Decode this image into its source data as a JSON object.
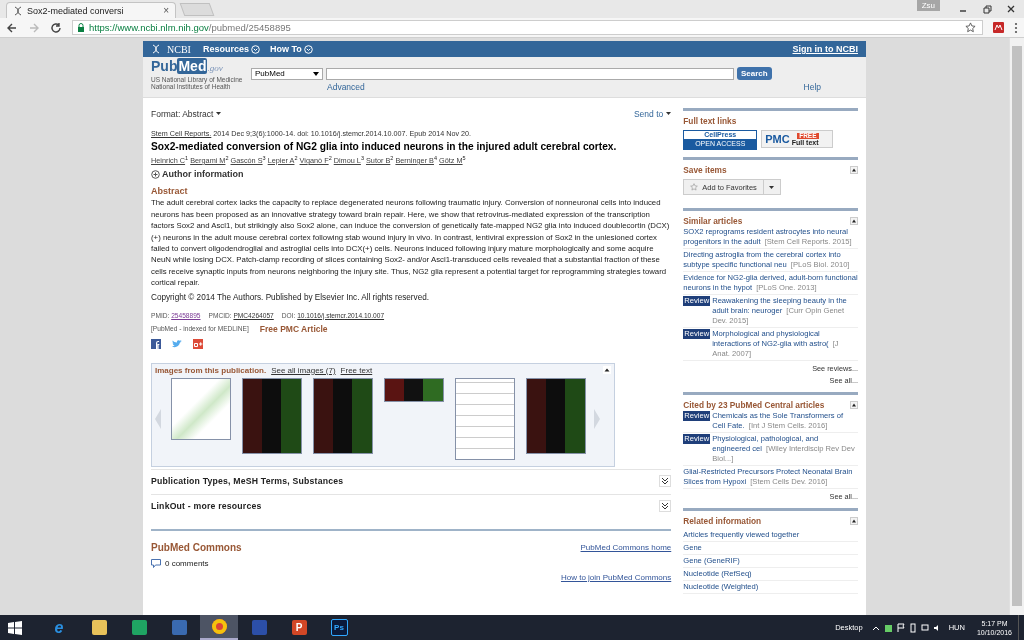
{
  "browser": {
    "tab_title": "Sox2-mediated conversi",
    "tab_close": "×",
    "user": "Zsu",
    "url_host": "https://www.ncbi.nlm.nih.gov",
    "url_path": "/pubmed/25458895"
  },
  "ncbi_bar": {
    "logo": "NCBI",
    "menus": [
      "Resources",
      "How To"
    ],
    "sign_in": "Sign in to NCBI"
  },
  "header": {
    "logo": {
      "pub": "Pub",
      "med": "Med",
      "suffix": ".gov"
    },
    "subtitle": [
      "US National Library of Medicine",
      "National Institutes of Health"
    ],
    "database": "PubMed",
    "search_button": "Search",
    "advanced": "Advanced",
    "help": "Help"
  },
  "article": {
    "format_label": "Format:",
    "format_value": "Abstract",
    "send_to": "Send to",
    "journal": "Stem Cell Reports.",
    "citation": " 2014 Dec 9;3(6):1000-14. doi: 10.1016/j.stemcr.2014.10.007. Epub 2014 Nov 20.",
    "title": "Sox2-mediated conversion of NG2 glia into induced neurons in the injured adult cerebral cortex.",
    "authors": [
      {
        "name": "Heinrich C",
        "sup": "1"
      },
      {
        "name": "Bergami M",
        "sup": "2"
      },
      {
        "name": "Gascón S",
        "sup": "3"
      },
      {
        "name": "Lepier A",
        "sup": "2"
      },
      {
        "name": "Viganò F",
        "sup": "2"
      },
      {
        "name": "Dimou L",
        "sup": "3"
      },
      {
        "name": "Sutor B",
        "sup": "2"
      },
      {
        "name": "Berninger B",
        "sup": "4"
      },
      {
        "name": "Götz M",
        "sup": "5"
      }
    ],
    "author_info": {
      "label": "Author information",
      "expanded": false
    },
    "abstract_heading": "Abstract",
    "abstract": "The adult cerebral cortex lacks the capacity to replace degenerated neurons following traumatic injury. Conversion of nonneuronal cells into induced neurons has been proposed as an innovative strategy toward brain repair. Here, we show that retrovirus-mediated expression of the transcription factors Sox2 and Ascl1, but strikingly also Sox2 alone, can induce the conversion of genetically fate-mapped NG2 glia into induced doublecortin (DCX)(+) neurons in the adult mouse cerebral cortex following stab wound injury in vivo. In contrast, lentiviral expression of Sox2 in the unlesioned cortex failed to convert oligodendroglial and astroglial cells into DCX(+) cells. Neurons induced following injury mature morphologically and some acquire NeuN while losing DCX. Patch-clamp recording of slices containing Sox2- and/or Ascl1-transduced cells revealed that a substantial fraction of these cells receive synaptic inputs from neurons neighboring the injury site. Thus, NG2 glia represent a potential target for reprogramming strategies toward cortical repair.",
    "copyright": "Copyright © 2014 The Authors. Published by Elsevier Inc. All rights reserved.",
    "ids": [
      {
        "label": "PMID:",
        "value": "25458895"
      },
      {
        "label": "PMCID:",
        "value": "PMC4264057"
      },
      {
        "label": "DOI:",
        "value": "10.1016/j.stemcr.2014.10.007"
      }
    ],
    "indexed": "[PubMed - indexed for MEDLINE]",
    "free_pmc": "Free PMC Article",
    "images": {
      "heading": "Images from this publication.",
      "links": [
        "See all images (7)",
        "Free text"
      ],
      "thumbnails": [
        {
          "kind": "diagram"
        },
        {
          "kind": "micrograph"
        },
        {
          "kind": "micrograph"
        },
        {
          "kind": "strip"
        },
        {
          "kind": "chart"
        },
        {
          "kind": "micrograph"
        }
      ]
    },
    "sections": [
      {
        "label": "Publication Types, MeSH Terms, Substances",
        "expanded": false
      },
      {
        "label": "LinkOut - more resources",
        "expanded": false
      }
    ],
    "commons": {
      "heading": "PubMed Commons",
      "home_link": "PubMed Commons home",
      "comments": "0 comments",
      "join_link": "How to join PubMed Commons"
    }
  },
  "sidebar": {
    "full_text": {
      "heading": "Full text links",
      "cellpress": {
        "top": "CellPress",
        "bottom": "OPEN ACCESS"
      },
      "pmc": {
        "logo": "PMC",
        "free": "FREE",
        "label": "Full text"
      }
    },
    "save": {
      "heading": "Save items",
      "button": "Add to Favorites",
      "expanded": true
    },
    "similar": {
      "heading": "Similar articles",
      "expanded": true,
      "items": [
        {
          "title": "SOX2 reprograms resident astrocytes into neural progenitors in the adult",
          "source": "[Stem Cell Reports. 2015]"
        },
        {
          "title": "Directing astroglia from the cerebral cortex into subtype specific functional neu",
          "source": "[PLoS Biol. 2010]"
        },
        {
          "title": "Evidence for NG2-glia derived, adult-born functional neurons in the hypot",
          "source": "[PLoS One. 2013]"
        },
        {
          "badge": "Review",
          "title": "Reawakening the sleeping beauty in the adult brain: neuroger",
          "source": "[Curr Opin Genet Dev. 2015]"
        },
        {
          "badge": "Review",
          "title": "Morphological and physiological interactions of NG2-glia with astro(",
          "source": "[J Anat. 2007]"
        }
      ],
      "links": [
        "See reviews...",
        "See all..."
      ]
    },
    "cited": {
      "heading": "Cited by 23 PubMed Central articles",
      "expanded": true,
      "items": [
        {
          "badge": "Review",
          "title": "Chemicals as the Sole Transformers of Cell Fate.",
          "source": "[Int J Stem Cells. 2016]"
        },
        {
          "badge": "Review",
          "title": "Physiological, pathological, and engineered cel",
          "source": "[Wiley Interdiscip Rev Dev Biol...]"
        },
        {
          "title": "Glial-Restricted Precursors Protect Neonatal Brain Slices from Hypoxi",
          "source": "[Stem Cells Dev. 2016]"
        }
      ],
      "links": [
        "See all..."
      ]
    },
    "related": {
      "heading": "Related information",
      "expanded": true,
      "items": [
        "Articles frequently viewed together",
        "Gene",
        "Gene (GeneRIF)",
        "Nucleotide (RefSeq)",
        "Nucleotide (Weighted)"
      ]
    }
  },
  "taskbar": {
    "apps": [
      {
        "kind": "ie",
        "glyph": "e",
        "selected": false
      },
      {
        "kind": "folder",
        "selected": false
      },
      {
        "kind": "drive",
        "selected": false
      },
      {
        "kind": "remote",
        "selected": false
      },
      {
        "kind": "chrome",
        "selected": true
      },
      {
        "kind": "floppy",
        "selected": false
      },
      {
        "kind": "powerpoint",
        "glyph": "P",
        "selected": false
      },
      {
        "kind": "photoshop",
        "glyph": "Ps",
        "selected": false
      }
    ],
    "desktop": "Desktop",
    "language": "HUN",
    "time": "5:17 PM",
    "date": "10/10/2016"
  }
}
